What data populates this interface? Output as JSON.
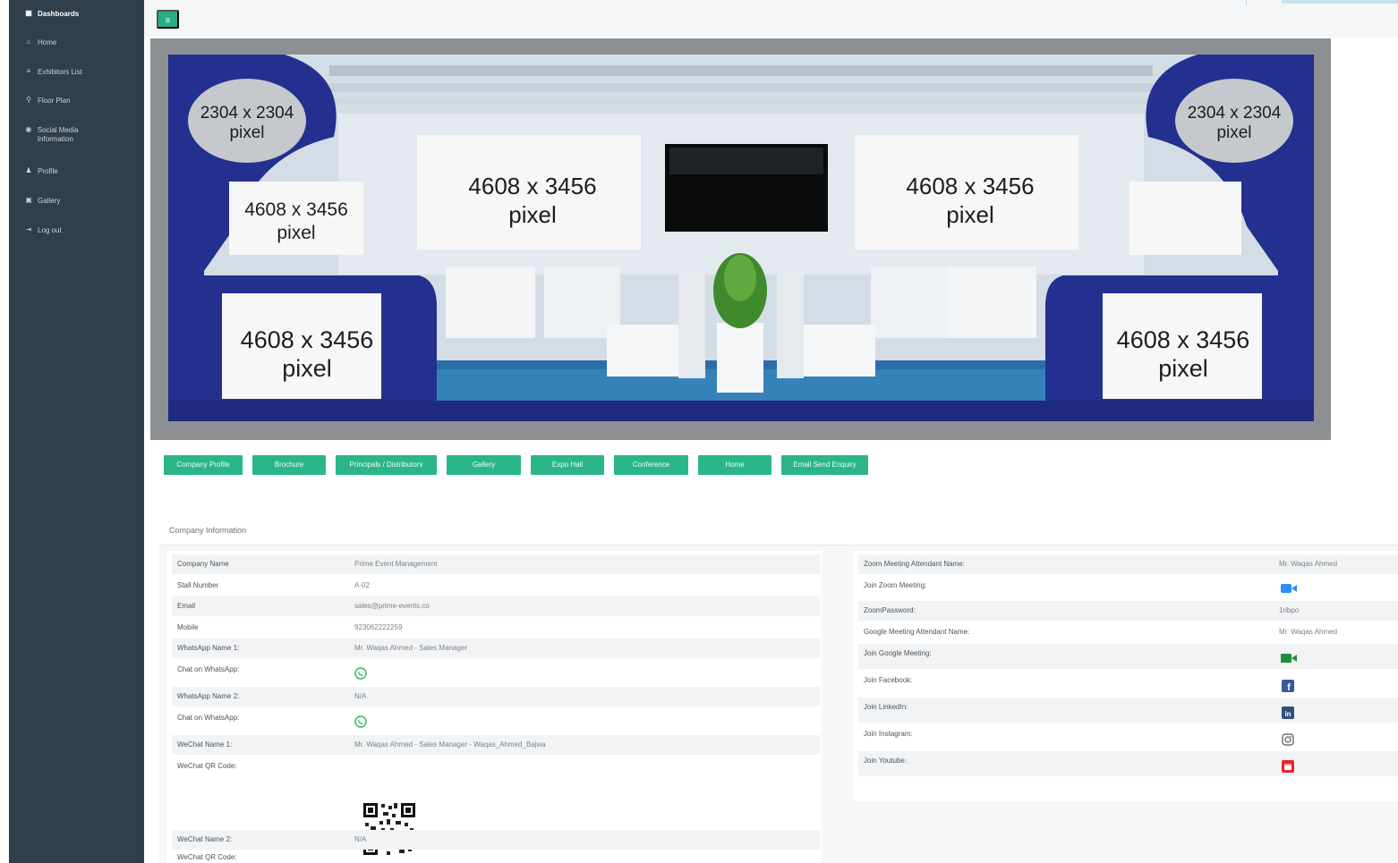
{
  "sidebar": {
    "items": [
      {
        "icon": "dashboard-icon",
        "label": "Dashboards"
      },
      {
        "icon": "home-icon",
        "label": "Home"
      },
      {
        "icon": "list-icon",
        "label": "Exhibitors List"
      },
      {
        "icon": "map-icon",
        "label": "Floor Plan"
      },
      {
        "icon": "social-icon",
        "label": "Social Media Information"
      },
      {
        "icon": "user-icon",
        "label": "Profile"
      },
      {
        "icon": "image-icon",
        "label": "Gallery"
      },
      {
        "icon": "logout-icon",
        "label": "Log out"
      }
    ]
  },
  "booth": {
    "small_panel_text": "2304 x 2304\npixel",
    "large_panel_text": "4608 x 3456\npixel"
  },
  "actions": [
    "Company Profile",
    "Brochure",
    "Principals / Distributors",
    "Gallery",
    "Expo Hall",
    "Conference",
    "Home",
    "Email Send Enquiry"
  ],
  "company_info": {
    "title": "Company Information",
    "rows": [
      {
        "key": "Company Name",
        "value": "Prime Event Management"
      },
      {
        "key": "Stall Number",
        "value": "A-02"
      },
      {
        "key": "Email",
        "value": "sales@prime-events.co"
      },
      {
        "key": "Mobile",
        "value": "923062222259"
      },
      {
        "key": "WhatsApp Name 1:",
        "value": "Mr. Waqas Ahmed - Sales Manager"
      },
      {
        "key": "Chat on WhatsApp:",
        "value": ""
      },
      {
        "key": "WhatsApp Name 2:",
        "value": "N/A"
      },
      {
        "key": "Chat on WhatsApp:",
        "value": ""
      },
      {
        "key": "WeChat Name 1:",
        "value": "Mr. Waqas Ahmed - Sales Manager - Waqas_Ahmed_Bajwa"
      },
      {
        "key": "WeChat QR Code:",
        "value": ""
      },
      {
        "key": "WeChat Name 2:",
        "value": "N/A"
      },
      {
        "key": "WeChat QR Code:",
        "value": ""
      }
    ]
  },
  "meeting_info": {
    "rows": [
      {
        "key": "Zoom Meeting Attendant Name:",
        "value": "Mr. Waqas Ahmed"
      },
      {
        "key": "Join Zoom Meeting:",
        "value": ""
      },
      {
        "key": "ZoomPassword:",
        "value": "1ribpo"
      },
      {
        "key": "Google Meeting Attendant Name:",
        "value": "Mr. Waqas Ahmed"
      },
      {
        "key": "Join Google Meeting:",
        "value": ""
      },
      {
        "key": "Join Facebook:",
        "value": ""
      },
      {
        "key": "Join LinkedIn:",
        "value": ""
      },
      {
        "key": "Join Instagram:",
        "value": ""
      },
      {
        "key": "Join Youtube:",
        "value": ""
      }
    ]
  },
  "colors": {
    "sidebar_bg": "#2f3f4c",
    "accent_green": "#2bb58b",
    "booth_blue": "#23308f"
  }
}
